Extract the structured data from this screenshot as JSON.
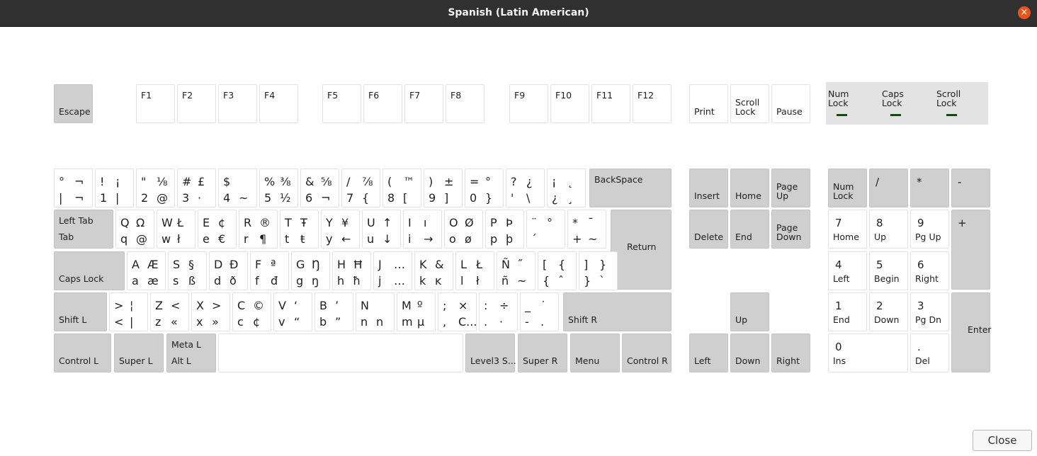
{
  "window": {
    "title": "Spanish (Latin American)",
    "close_icon": "×"
  },
  "footer": {
    "close_label": "Close"
  },
  "indicators": [
    {
      "id": "num",
      "label": "Num\nLock"
    },
    {
      "id": "caps",
      "label": "Caps\nLock"
    },
    {
      "id": "scroll",
      "label": "Scroll\nLock"
    }
  ],
  "keys": {
    "esc": [
      "Escape"
    ],
    "f1": [
      "F1"
    ],
    "f2": [
      "F2"
    ],
    "f3": [
      "F3"
    ],
    "f4": [
      "F4"
    ],
    "f5": [
      "F5"
    ],
    "f6": [
      "F6"
    ],
    "f7": [
      "F7"
    ],
    "f8": [
      "F8"
    ],
    "f9": [
      "F9"
    ],
    "f10": [
      "F10"
    ],
    "f11": [
      "F11"
    ],
    "f12": [
      "F12"
    ],
    "print": [
      "Print"
    ],
    "scrolllock": [
      "Scroll\nLock"
    ],
    "pause": [
      "Pause"
    ],
    "grave": [
      "°",
      "¬",
      "|",
      "¬"
    ],
    "k1": [
      "!",
      "¡",
      "1",
      "|"
    ],
    "k2": [
      "\"",
      "⅛",
      "2",
      "@"
    ],
    "k3": [
      "#",
      "£",
      "3",
      "·"
    ],
    "k4": [
      "$",
      "",
      "4",
      "~"
    ],
    "k5": [
      "%",
      "⅜",
      "5",
      "½"
    ],
    "k6": [
      "&",
      "⅝",
      "6",
      "¬"
    ],
    "k7": [
      "/",
      "⅞",
      "7",
      "{"
    ],
    "k8": [
      "(",
      "™",
      "8",
      "["
    ],
    "k9": [
      ")",
      "±",
      "9",
      "]"
    ],
    "k0": [
      "=",
      "°",
      "0",
      "}"
    ],
    "minus": [
      "?",
      "¿",
      "'",
      "\\"
    ],
    "equal": [
      "¡",
      "˛",
      "¿",
      "¸"
    ],
    "backspace": [
      "BackSpace"
    ],
    "tab": [
      "Left Tab",
      "Tab"
    ],
    "q": [
      "Q",
      "Ω",
      "q",
      "@"
    ],
    "w": [
      "W",
      "Ł",
      "w",
      "ł"
    ],
    "e": [
      "E",
      "¢",
      "e",
      "€"
    ],
    "r": [
      "R",
      "®",
      "r",
      "¶"
    ],
    "t": [
      "T",
      "Ŧ",
      "t",
      "ŧ"
    ],
    "y": [
      "Y",
      "¥",
      "y",
      "←"
    ],
    "u": [
      "U",
      "↑",
      "u",
      "↓"
    ],
    "i": [
      "I",
      "ı",
      "i",
      "→"
    ],
    "o": [
      "O",
      "Ø",
      "o",
      "ø"
    ],
    "p": [
      "P",
      "Þ",
      "p",
      "þ"
    ],
    "lbracket": [
      "¨",
      "°",
      "´",
      ""
    ],
    "rbracket": [
      "*",
      "¯",
      "+",
      "~"
    ],
    "return": [
      "Return"
    ],
    "caps": [
      "Caps Lock"
    ],
    "a": [
      "A",
      "Æ",
      "a",
      "æ"
    ],
    "s": [
      "S",
      "§",
      "s",
      "ß"
    ],
    "d": [
      "D",
      "Ð",
      "d",
      "ð"
    ],
    "f": [
      "F",
      "ª",
      "f",
      "đ"
    ],
    "g": [
      "G",
      "Ŋ",
      "g",
      "ŋ"
    ],
    "h": [
      "H",
      "Ħ",
      "h",
      "ħ"
    ],
    "j": [
      "J",
      "…",
      "j",
      "…"
    ],
    "k": [
      "K",
      "&",
      "k",
      "ĸ"
    ],
    "l": [
      "L",
      "Ł",
      "l",
      "ł"
    ],
    "semi": [
      "Ñ",
      "˝",
      "ñ",
      "~"
    ],
    "apos": [
      "[",
      "{",
      "{",
      "ˆ"
    ],
    "bslash": [
      "]",
      "}",
      "}",
      "`"
    ],
    "lshift": [
      "Shift L"
    ],
    "lsgt": [
      ">",
      "¦",
      "<",
      "|"
    ],
    "z": [
      "Z",
      "<",
      "z",
      "«"
    ],
    "x": [
      "X",
      ">",
      "x",
      "»"
    ],
    "c": [
      "C",
      "©",
      "c",
      "¢"
    ],
    "v": [
      "V",
      "‘",
      "v",
      "“"
    ],
    "b": [
      "B",
      "’",
      "b",
      "”"
    ],
    "n": [
      "N",
      "",
      "n",
      "n"
    ],
    "m": [
      "M",
      "º",
      "m",
      "µ"
    ],
    "comma": [
      ";",
      "×",
      ",",
      "C..."
    ],
    "period": [
      ":",
      "÷",
      ".",
      "·"
    ],
    "slash": [
      "_",
      "˙",
      "-",
      "."
    ],
    "rshift": [
      "Shift R"
    ],
    "lctrl": [
      "Control L"
    ],
    "lsuper": [
      "Super L"
    ],
    "alt": [
      "Meta L",
      "Alt L"
    ],
    "space": [
      ""
    ],
    "level3": [
      "Level3 S..."
    ],
    "rsuper": [
      "Super R"
    ],
    "menu": [
      "Menu"
    ],
    "rctrl": [
      "Control R"
    ],
    "insert": [
      "Insert"
    ],
    "home": [
      "Home"
    ],
    "pgup": [
      "Page\nUp"
    ],
    "delete": [
      "Delete"
    ],
    "end": [
      "End"
    ],
    "pgdn": [
      "Page\nDown"
    ],
    "up": [
      "Up"
    ],
    "left": [
      "Left"
    ],
    "down": [
      "Down"
    ],
    "right": [
      "Right"
    ],
    "numlock": [
      "Num\nLock"
    ],
    "kpdiv": [
      "/"
    ],
    "kpmul": [
      "*"
    ],
    "kpsub": [
      "-"
    ],
    "kp7": [
      "7",
      "Home"
    ],
    "kp8": [
      "8",
      "Up"
    ],
    "kp9": [
      "9",
      "Pg Up"
    ],
    "kpadd": [
      "+"
    ],
    "kp4": [
      "4",
      "Left"
    ],
    "kp5": [
      "5",
      "Begin"
    ],
    "kp6": [
      "6",
      "Right"
    ],
    "kp1": [
      "1",
      "End"
    ],
    "kp2": [
      "2",
      "Down"
    ],
    "kp3": [
      "3",
      "Pg Dn"
    ],
    "kpenter": [
      "Enter"
    ],
    "kp0": [
      "0",
      "Ins"
    ],
    "kpdot": [
      ".",
      "Del"
    ]
  }
}
